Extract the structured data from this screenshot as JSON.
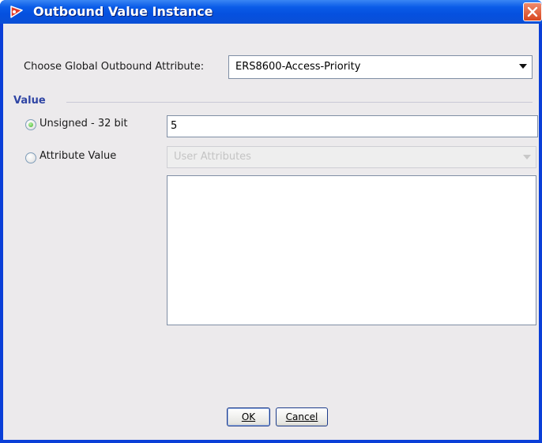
{
  "window": {
    "title": "Outbound Value Instance"
  },
  "global_attribute": {
    "label": "Choose Global Outbound Attribute:",
    "selected": "ERS8600-Access-Priority"
  },
  "value_section": {
    "title": "Value",
    "unsigned_radio_label": "Unsigned - 32 bit",
    "unsigned_value": "5",
    "attribute_radio_label": "Attribute Value",
    "attribute_select_value": "User Attributes",
    "selected_option": "unsigned"
  },
  "buttons": {
    "ok": "OK",
    "cancel": "Cancel"
  },
  "colors": {
    "titlebar": "#0a5ce8",
    "dialog_bg": "#eceaec",
    "section_title": "#2f45a4"
  },
  "icons": {
    "title": "app-logo-icon",
    "close": "close-icon",
    "dropdown": "chevron-down-icon"
  }
}
